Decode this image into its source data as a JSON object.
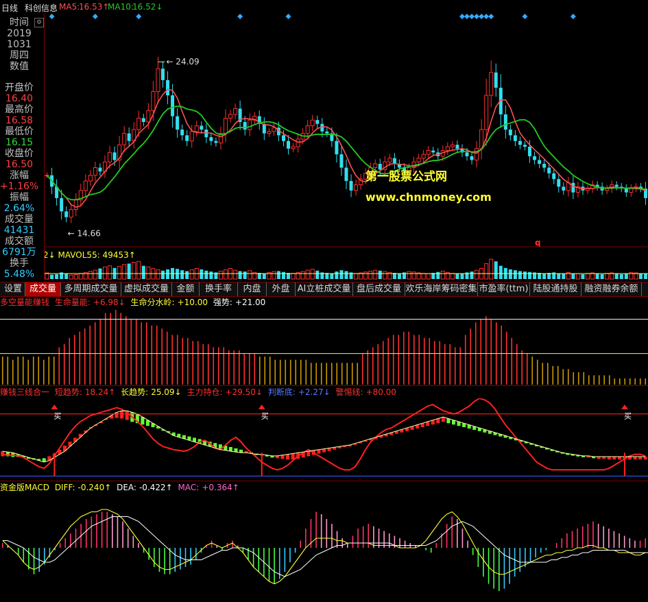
{
  "header": {
    "period": "日线",
    "name": "科创信息",
    "ma5_label": "MA5:",
    "ma5_value": "16.53↑",
    "ma10_label": "MA10:",
    "ma10_value": "16.52↓"
  },
  "info": {
    "rows": [
      {
        "text": "时间",
        "color": "#c0c0c0"
      },
      {
        "text": "2019",
        "color": "#c0c0c0"
      },
      {
        "text": "1031",
        "color": "#c0c0c0"
      },
      {
        "text": "周四",
        "color": "#c0c0c0"
      },
      {
        "text": "数值",
        "color": "#c0c0c0"
      },
      {
        "text": "开盘价",
        "color": "#c0c0c0"
      },
      {
        "text": "16.40",
        "color": "#ff4040"
      },
      {
        "text": "最高价",
        "color": "#c0c0c0"
      },
      {
        "text": "16.58",
        "color": "#ff4040"
      },
      {
        "text": "最低价",
        "color": "#c0c0c0"
      },
      {
        "text": "16.15",
        "color": "#33dd33"
      },
      {
        "text": "收盘价",
        "color": "#c0c0c0"
      },
      {
        "text": "16.50",
        "color": "#ff4040"
      },
      {
        "text": "涨幅",
        "color": "#c0c0c0"
      },
      {
        "text": "+1.16%",
        "color": "#ff4040"
      },
      {
        "text": "振幅",
        "color": "#c0c0c0"
      },
      {
        "text": "2.64%",
        "color": "#33ccff"
      },
      {
        "text": "成交量",
        "color": "#c0c0c0"
      },
      {
        "text": "41431",
        "color": "#33ccff"
      },
      {
        "text": "成交额",
        "color": "#c0c0c0"
      },
      {
        "text": "6791万",
        "color": "#33ccff"
      },
      {
        "text": "换手",
        "color": "#c0c0c0"
      },
      {
        "text": "5.48%",
        "color": "#33ccff"
      }
    ]
  },
  "watermark": {
    "line1": "第一股票公式网",
    "line2": "www.chnmoney.com"
  },
  "volume_header": {
    "prefix": "2↓",
    "label": "MAVOL55:",
    "value": "49453↑"
  },
  "tabs": [
    "设置",
    "成交量",
    "多周期成交量",
    "虚拟成交量",
    "金额",
    "换手率",
    "内盘",
    "外盘",
    "AI立桩成交量",
    "盘后成交量",
    "欢乐海岸筹码密集",
    "市盈率(ttm)",
    "陆股通持股",
    "融资融券余额"
  ],
  "active_tab": 1,
  "panel1": {
    "name": "多空量能赚钱",
    "items": [
      {
        "label": "生命量能:",
        "value": "+6.98↓"
      },
      {
        "label": "生命分水岭:",
        "value": "+10.00"
      },
      {
        "label": "强势:",
        "value": "+21.00"
      }
    ]
  },
  "panel2": {
    "name": "赚钱三线合一",
    "items": [
      {
        "label": "短趋势:",
        "value": "18.24↑"
      },
      {
        "label": "长趋势:",
        "value": "25.09↓"
      },
      {
        "label": "主力持仓:",
        "value": "+29.50↓"
      },
      {
        "label": "判断底:",
        "value": "+2.27↓"
      },
      {
        "label": "警惕线:",
        "value": "+80.00"
      }
    ],
    "buy_label": "买"
  },
  "panel3": {
    "name": "资金版MACD",
    "items": [
      {
        "label": "DIFF:",
        "value": "-0.240↑"
      },
      {
        "label": "DEA:",
        "value": "-0.422↑"
      },
      {
        "label": "MAC:",
        "value": "+0.364↑"
      }
    ]
  },
  "colors": {
    "up": "#ff3030",
    "down": "#33ddee",
    "ma5": "#ff5050",
    "ma10": "#22cc22",
    "yellow": "#ffff33",
    "white": "#ffffff"
  },
  "chart_data": [
    {
      "type": "candlestick",
      "series": [
        {
          "name": "MA5"
        },
        {
          "name": "MA10"
        }
      ],
      "annotations": [
        {
          "text": "24.09",
          "kind": "high"
        },
        {
          "text": "14.66",
          "kind": "low"
        }
      ],
      "marker_text": "q",
      "ylim": [
        13.8,
        25.4
      ],
      "note_points": "close prices estimated",
      "closes": [
        17.2,
        16.6,
        16.0,
        15.3,
        15.0,
        15.4,
        15.9,
        16.4,
        16.9,
        17.2,
        17.6,
        17.4,
        17.9,
        18.4,
        18.0,
        18.8,
        19.4,
        19.0,
        19.6,
        20.2,
        20.0,
        20.6,
        21.6,
        22.8,
        22.2,
        21.4,
        20.3,
        19.6,
        19.3,
        19.0,
        19.5,
        19.8,
        19.6,
        19.2,
        19.0,
        18.9,
        19.4,
        20.2,
        20.4,
        20.7,
        20.0,
        19.6,
        20.1,
        20.3,
        19.9,
        19.4,
        19.5,
        19.7,
        19.3,
        19.0,
        18.6,
        18.7,
        19.1,
        19.4,
        19.8,
        20.1,
        19.9,
        19.5,
        19.4,
        19.0,
        18.3,
        17.6,
        16.9,
        16.4,
        16.7,
        17.0,
        17.3,
        17.6,
        17.8,
        17.5,
        17.9,
        18.1,
        17.8,
        17.6,
        17.4,
        17.6,
        17.9,
        18.1,
        18.3,
        18.5,
        18.4,
        18.2,
        18.5,
        18.7,
        18.8,
        18.6,
        18.4,
        18.2,
        18.0,
        18.6,
        19.6,
        21.4,
        22.6,
        21.8,
        20.4,
        19.6,
        19.3,
        19.0,
        18.8,
        18.7,
        18.2,
        18.0,
        17.8,
        17.6,
        17.3,
        17.0,
        16.6,
        16.4,
        16.8,
        16.3,
        16.6,
        16.4,
        16.5,
        16.7,
        16.6,
        16.4,
        16.5,
        16.7,
        16.6,
        16.5,
        16.3,
        16.5,
        16.6,
        16.5,
        16.0
      ],
      "ma_note": "MA5 / MA10 computed from closes"
    },
    {
      "type": "bar",
      "series": [
        {
          "name": "MAVOL55",
          "value": 49453
        }
      ],
      "volumes": [
        28,
        20,
        22,
        30,
        25,
        18,
        20,
        26,
        30,
        35,
        40,
        48,
        55,
        60,
        50,
        58,
        66,
        70,
        76,
        80,
        60,
        55,
        48,
        42,
        38,
        44,
        50,
        46,
        40,
        36,
        42,
        48,
        44,
        38,
        34,
        30,
        36,
        42,
        48,
        40,
        36,
        34,
        38,
        30,
        28,
        26,
        30,
        34,
        36,
        32,
        28,
        26,
        30,
        34,
        40,
        44,
        38,
        30,
        28,
        26,
        34,
        40,
        36,
        30,
        26,
        28,
        32,
        36,
        40,
        38,
        34,
        30,
        28,
        26,
        30,
        34,
        32,
        28,
        26,
        24,
        28,
        32,
        36,
        30,
        26,
        24,
        26,
        30,
        34,
        40,
        48,
        70,
        90,
        80,
        60,
        50,
        44,
        40,
        36,
        34,
        32,
        30,
        28,
        26,
        28,
        30,
        26,
        24,
        30,
        26,
        24,
        22,
        26,
        28,
        24,
        22,
        26,
        28,
        24,
        22,
        26,
        30,
        28,
        26,
        24
      ]
    },
    {
      "type": "bar",
      "title": "多空量能赚钱",
      "lines": [
        {
          "name": "生命分水岭",
          "value": 10.0
        },
        {
          "name": "强势",
          "value": 21.0
        }
      ],
      "ylim": [
        0,
        24
      ],
      "values": [
        9,
        9,
        8,
        9,
        9,
        8,
        9,
        9,
        8,
        9,
        9,
        12,
        13,
        15,
        16,
        17,
        18,
        19,
        20,
        21,
        23,
        23,
        24,
        23,
        22,
        21,
        21,
        20,
        20,
        19,
        19,
        18,
        17,
        16,
        16,
        15,
        15,
        14,
        14,
        13,
        13,
        12,
        12,
        12,
        11,
        11,
        11,
        10,
        10,
        10,
        9,
        9,
        9,
        8,
        8,
        8,
        8,
        8,
        8,
        8,
        7,
        7,
        7,
        7,
        7,
        7,
        7,
        7,
        7,
        7,
        10,
        11,
        12,
        13,
        14,
        15,
        16,
        16,
        17,
        17,
        16,
        16,
        15,
        15,
        14,
        14,
        13,
        13,
        12,
        12,
        16,
        18,
        20,
        21,
        22,
        21,
        20,
        19,
        17,
        15,
        13,
        11,
        10,
        9,
        8,
        7,
        7,
        6,
        6,
        5,
        5,
        4,
        4,
        4,
        3,
        3,
        3,
        3,
        3,
        2,
        2,
        2,
        2,
        2,
        2,
        2
      ],
      "note": "amber bars = below 生命分水岭 line, red bars above"
    },
    {
      "type": "line",
      "title": "赚钱三线合一",
      "ylim": [
        -5,
        100
      ],
      "short_trend": [
        28,
        27,
        27,
        26,
        24,
        20,
        16,
        12,
        10,
        16,
        26,
        36,
        46,
        56,
        64,
        70,
        74,
        78,
        80,
        82,
        84,
        86,
        88,
        86,
        82,
        76,
        70,
        64,
        56,
        48,
        42,
        38,
        36,
        34,
        33,
        32,
        34,
        38,
        44,
        46,
        42,
        36,
        34,
        40,
        46,
        50,
        44,
        36,
        30,
        24,
        18,
        14,
        10,
        8,
        10,
        14,
        20,
        26,
        30,
        34,
        30,
        26,
        22,
        18,
        14,
        10,
        8,
        8,
        12,
        22,
        34,
        44,
        50,
        56,
        60,
        62,
        66,
        70,
        74,
        78,
        82,
        86,
        90,
        92,
        88,
        84,
        82,
        80,
        82,
        86,
        90,
        96,
        100,
        98,
        94,
        86,
        76,
        66,
        58,
        50,
        42,
        34,
        26,
        18,
        14,
        10,
        8,
        8,
        8,
        8,
        8,
        8,
        8,
        8,
        8,
        8,
        8,
        10,
        14,
        18,
        22,
        26,
        28,
        28,
        26
      ],
      "long_trend": [
        30,
        30,
        29,
        29,
        28,
        27,
        27,
        26,
        27,
        30,
        34,
        40,
        46,
        52,
        58,
        64,
        69,
        74,
        78,
        82,
        85,
        87,
        88,
        87,
        85,
        82,
        80,
        78,
        76,
        74,
        72,
        70,
        68,
        66,
        64,
        62,
        60,
        58,
        56,
        54,
        52,
        50,
        48,
        46,
        44,
        42,
        40,
        38,
        36,
        34,
        32,
        30,
        28,
        27,
        26,
        25,
        25,
        26,
        28,
        30,
        32,
        34,
        36,
        38,
        40,
        42,
        44,
        46,
        48,
        50,
        52,
        54,
        56,
        58,
        60,
        62,
        64,
        66,
        68,
        70,
        72,
        74,
        76,
        78,
        80,
        82,
        80,
        78,
        76,
        74,
        72,
        70,
        68,
        66,
        64,
        62,
        60,
        58,
        56,
        54,
        52,
        50,
        48,
        46,
        44,
        42,
        40,
        38,
        36,
        34,
        32,
        30,
        29,
        28,
        27,
        26,
        26,
        25,
        25,
        25,
        25,
        25,
        25,
        25,
        25
      ],
      "trend_bars": "red rising / green falling bars between long-trend and its reference",
      "main_position": [
        32,
        31,
        30,
        28,
        26,
        24,
        22,
        20,
        18,
        20,
        24,
        28,
        32,
        38,
        44,
        50,
        56,
        62,
        66,
        70,
        74,
        78,
        82,
        84,
        84,
        82,
        80,
        76,
        72,
        68,
        64,
        60,
        56,
        52,
        50,
        48,
        46,
        44,
        42,
        40,
        38,
        36,
        34,
        33,
        32,
        31,
        30,
        30,
        29,
        28,
        28,
        27,
        26,
        26,
        27,
        28,
        29,
        30,
        31,
        32,
        33,
        34,
        35,
        36,
        37,
        38,
        39,
        40,
        42,
        44,
        46,
        48,
        50,
        52,
        54,
        56,
        58,
        60,
        62,
        64,
        66,
        68,
        70,
        72,
        74,
        76,
        74,
        72,
        70,
        68,
        66,
        64,
        62,
        60,
        58,
        56,
        54,
        52,
        50,
        48,
        46,
        44,
        42,
        40,
        38,
        36,
        34,
        32,
        30,
        29,
        28,
        27,
        26,
        26,
        25,
        25,
        25,
        25,
        25,
        25,
        25,
        25,
        25,
        25,
        25
      ],
      "warning_line": 80,
      "bottom_line": 0,
      "buy_points": [
        10,
        50,
        120
      ]
    },
    {
      "type": "bar",
      "title": "资金版MACD",
      "series": [
        {
          "name": "DIFF",
          "value": -0.24
        },
        {
          "name": "DEA",
          "value": -0.422
        },
        {
          "name": "MAC",
          "value": 0.364
        }
      ],
      "ylim": [
        -2.2,
        2.2
      ],
      "mac": [
        0.2,
        0.1,
        0.0,
        -0.3,
        -0.6,
        -0.9,
        -1.1,
        -1.0,
        -0.7,
        -0.4,
        -0.1,
        0.2,
        0.4,
        0.6,
        0.8,
        1.0,
        1.2,
        1.3,
        1.4,
        1.5,
        1.5,
        1.4,
        1.3,
        1.1,
        0.8,
        0.5,
        0.2,
        -0.2,
        -0.5,
        -0.8,
        -1.0,
        -1.1,
        -1.1,
        -1.0,
        -0.9,
        -0.8,
        -0.7,
        -0.5,
        -0.2,
        0.1,
        0.3,
        0.1,
        -0.1,
        0.2,
        0.3,
        0.1,
        -0.2,
        -0.5,
        -0.8,
        -1.0,
        -1.2,
        -1.4,
        -1.5,
        -1.3,
        -1.0,
        -0.6,
        -0.2,
        0.3,
        0.8,
        1.2,
        1.5,
        1.4,
        1.2,
        1.0,
        0.7,
        0.4,
        0.2,
        0.5,
        0.8,
        0.9,
        1.0,
        0.9,
        0.8,
        0.7,
        0.6,
        0.5,
        0.4,
        0.3,
        0.2,
        0.1,
        0.0,
        -0.1,
        -0.2,
        0.2,
        0.6,
        1.0,
        1.3,
        1.2,
        0.8,
        0.3,
        -0.3,
        -0.8,
        -1.2,
        -1.5,
        -1.7,
        -1.8,
        -1.7,
        -1.5,
        -1.2,
        -1.0,
        -0.8,
        -0.6,
        -0.4,
        -0.2,
        -0.1,
        0.0,
        0.2,
        0.4,
        0.6,
        0.7,
        0.8,
        0.9,
        1.0,
        1.1,
        1.0,
        0.9,
        0.8,
        0.7,
        0.6,
        0.5,
        0.4,
        0.3,
        0.3,
        0.4
      ],
      "diff": [
        0.3,
        0.1,
        -0.1,
        -0.3,
        -0.6,
        -0.8,
        -0.9,
        -0.8,
        -0.6,
        -0.3,
        0.0,
        0.3,
        0.6,
        0.9,
        1.1,
        1.3,
        1.4,
        1.5,
        1.5,
        1.6,
        1.6,
        1.5,
        1.4,
        1.2,
        0.9,
        0.6,
        0.3,
        0.0,
        -0.3,
        -0.6,
        -0.8,
        -0.9,
        -0.9,
        -0.8,
        -0.7,
        -0.6,
        -0.5,
        -0.3,
        -0.1,
        0.1,
        0.2,
        0.1,
        0.0,
        0.1,
        0.2,
        0.0,
        -0.2,
        -0.5,
        -0.8,
        -1.0,
        -1.2,
        -1.4,
        -1.5,
        -1.4,
        -1.2,
        -0.9,
        -0.6,
        -0.3,
        0.0,
        0.2,
        0.4,
        0.4,
        0.4,
        0.4,
        0.3,
        0.3,
        0.2,
        0.2,
        0.2,
        0.2,
        0.2,
        0.1,
        0.1,
        0.1,
        0.1,
        0.1,
        0.0,
        0.0,
        0.0,
        0.0,
        0.1,
        0.3,
        0.6,
        0.9,
        1.2,
        1.4,
        1.5,
        1.3,
        1.0,
        0.6,
        0.2,
        -0.2,
        -0.5,
        -0.8,
        -1.0,
        -1.1,
        -1.1,
        -1.0,
        -0.9,
        -0.8,
        -0.7,
        -0.6,
        -0.5,
        -0.4,
        -0.3,
        -0.3,
        -0.2,
        -0.2,
        -0.1,
        -0.1,
        0.0,
        0.0,
        0.1,
        0.1,
        0.0,
        0.0,
        -0.1,
        -0.1,
        -0.2,
        -0.2,
        -0.2,
        -0.3,
        -0.3,
        -0.2
      ],
      "dea": [
        0.3,
        0.3,
        0.2,
        0.1,
        0.0,
        -0.2,
        -0.4,
        -0.5,
        -0.6,
        -0.6,
        -0.5,
        -0.3,
        -0.1,
        0.1,
        0.3,
        0.5,
        0.7,
        0.9,
        1.0,
        1.1,
        1.2,
        1.3,
        1.3,
        1.3,
        1.3,
        1.2,
        1.1,
        0.9,
        0.7,
        0.5,
        0.3,
        0.1,
        -0.1,
        -0.3,
        -0.4,
        -0.5,
        -0.5,
        -0.5,
        -0.5,
        -0.4,
        -0.3,
        -0.2,
        -0.1,
        -0.1,
        0.0,
        0.0,
        0.0,
        -0.1,
        -0.2,
        -0.4,
        -0.6,
        -0.8,
        -1.0,
        -1.1,
        -1.2,
        -1.1,
        -1.0,
        -0.9,
        -0.7,
        -0.5,
        -0.3,
        -0.2,
        -0.1,
        0.0,
        0.1,
        0.1,
        0.2,
        0.2,
        0.2,
        0.2,
        0.2,
        0.2,
        0.2,
        0.2,
        0.2,
        0.1,
        0.1,
        0.1,
        0.1,
        0.1,
        0.1,
        0.1,
        0.2,
        0.3,
        0.5,
        0.7,
        0.9,
        1.0,
        1.1,
        1.0,
        0.9,
        0.7,
        0.5,
        0.3,
        0.1,
        -0.1,
        -0.3,
        -0.4,
        -0.5,
        -0.6,
        -0.6,
        -0.6,
        -0.6,
        -0.6,
        -0.6,
        -0.5,
        -0.5,
        -0.4,
        -0.4,
        -0.3,
        -0.3,
        -0.2,
        -0.2,
        -0.1,
        -0.1,
        -0.1,
        -0.1,
        -0.1,
        -0.1,
        -0.1,
        -0.2,
        -0.2,
        -0.2,
        -0.2,
        -0.2
      ]
    }
  ]
}
